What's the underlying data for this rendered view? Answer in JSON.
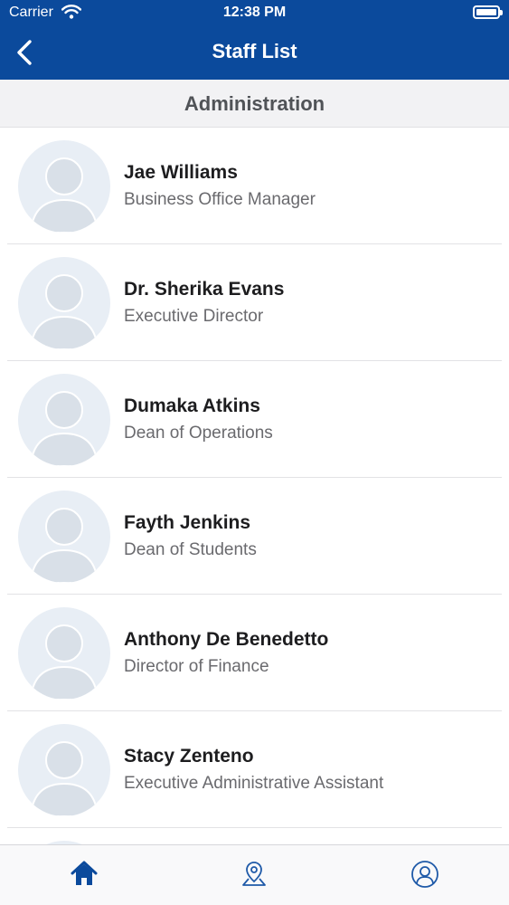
{
  "status_bar": {
    "carrier": "Carrier",
    "time": "12:38 PM"
  },
  "nav": {
    "title": "Staff List",
    "back_icon": "chevron-left-icon"
  },
  "section": {
    "title": "Administration"
  },
  "staff": [
    {
      "name": "Jae Williams",
      "role": "Business Office Manager"
    },
    {
      "name": "Dr. Sherika Evans",
      "role": "Executive Director"
    },
    {
      "name": "Dumaka Atkins",
      "role": "Dean of Operations"
    },
    {
      "name": "Fayth Jenkins",
      "role": "Dean of Students"
    },
    {
      "name": "Anthony De Benedetto",
      "role": "Director of Finance"
    },
    {
      "name": "Stacy Zenteno",
      "role": "Executive Administrative Assistant"
    }
  ],
  "tab_bar": {
    "tabs": [
      {
        "icon": "home-icon",
        "active": true
      },
      {
        "icon": "map-pin-icon",
        "active": false
      },
      {
        "icon": "profile-icon",
        "active": false
      }
    ]
  },
  "colors": {
    "brand": "#0b4a9c",
    "section_bg": "#f2f2f4",
    "avatar_bg": "#e8eef5",
    "avatar_silhouette": "#d9e0e8",
    "tab_active": "#0b4a9c",
    "tab_inactive": "#1f5aa8"
  }
}
